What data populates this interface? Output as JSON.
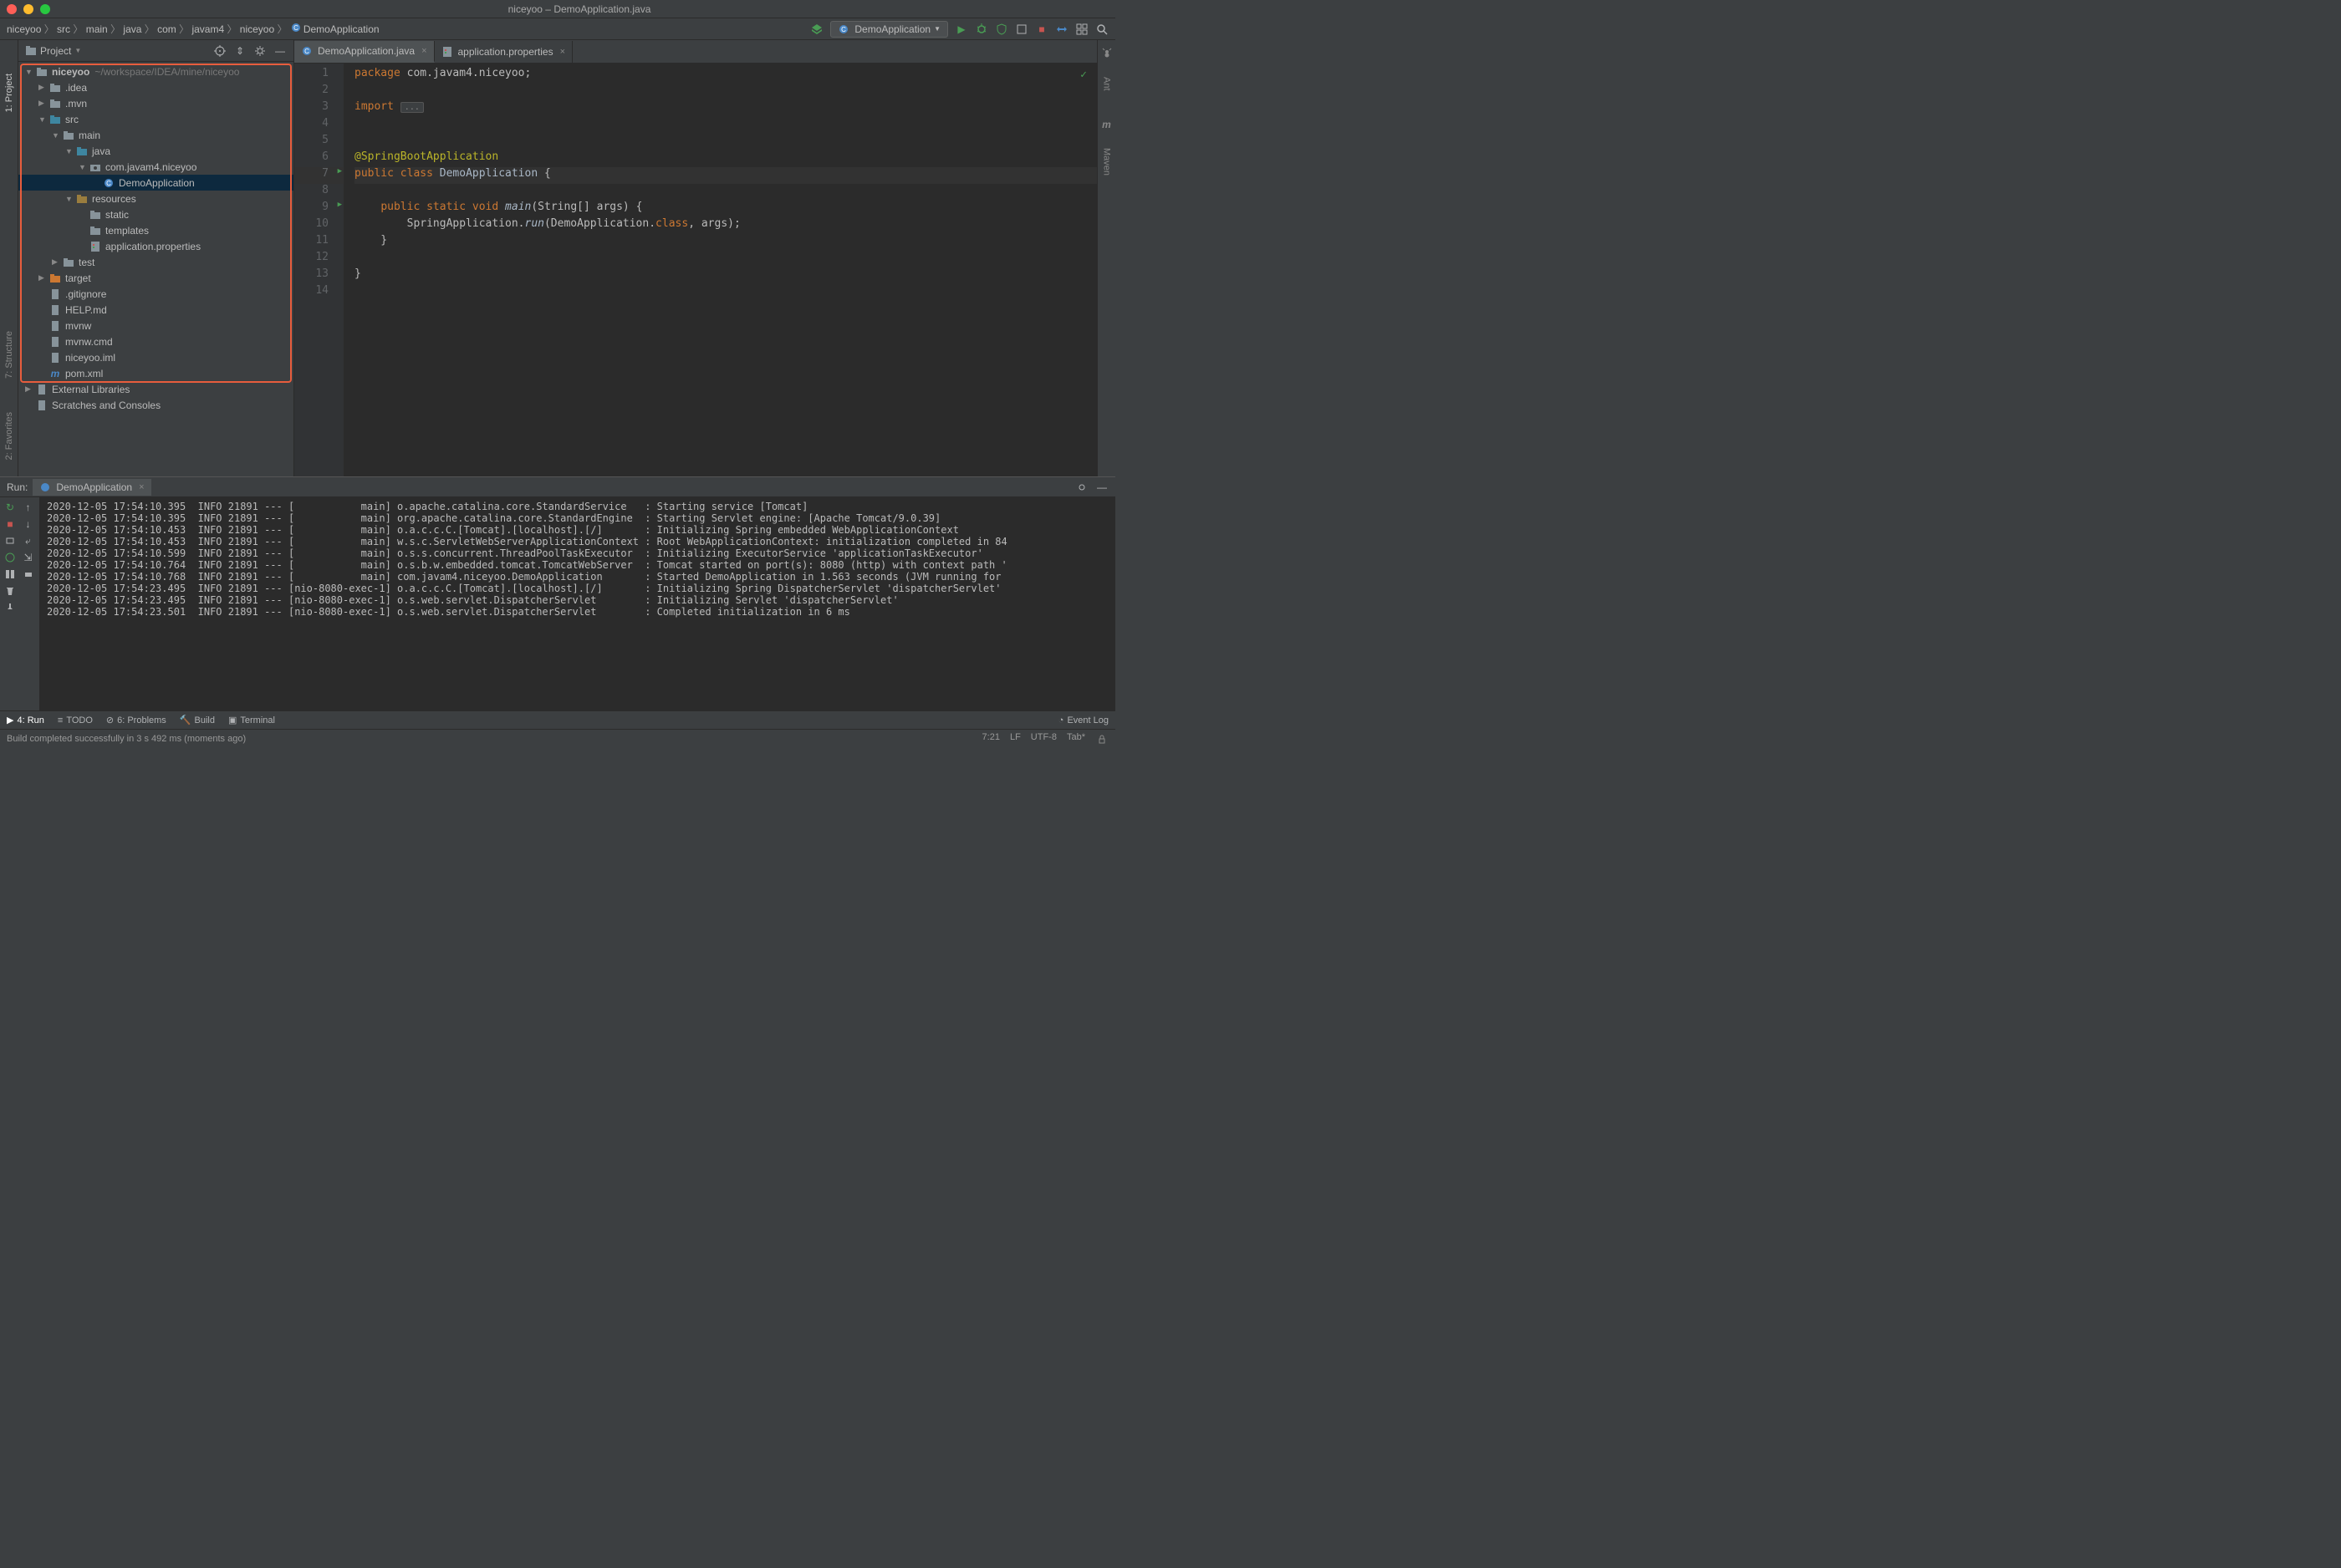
{
  "title": "niceyoo – DemoApplication.java",
  "breadcrumbs": [
    "niceyoo",
    "src",
    "main",
    "java",
    "com",
    "javam4",
    "niceyoo",
    "DemoApplication"
  ],
  "run_config": "DemoApplication",
  "left_tabs": {
    "project": "1: Project",
    "structure": "7: Structure",
    "favorites": "2: Favorites"
  },
  "right_tabs": {
    "ant": "Ant",
    "maven": "Maven"
  },
  "panel": {
    "title": "Project"
  },
  "tree": {
    "root": {
      "name": "niceyoo",
      "path": "~/workspace/IDEA/mine/niceyoo"
    },
    "children": [
      {
        "name": ".idea",
        "indent": 1,
        "arrow": ">",
        "icon": "folder"
      },
      {
        "name": ".mvn",
        "indent": 1,
        "arrow": ">",
        "icon": "folder"
      },
      {
        "name": "src",
        "indent": 1,
        "arrow": "v",
        "icon": "folder-src"
      },
      {
        "name": "main",
        "indent": 2,
        "arrow": "v",
        "icon": "folder"
      },
      {
        "name": "java",
        "indent": 3,
        "arrow": "v",
        "icon": "folder-src"
      },
      {
        "name": "com.javam4.niceyoo",
        "indent": 4,
        "arrow": "v",
        "icon": "package"
      },
      {
        "name": "DemoApplication",
        "indent": 5,
        "arrow": "",
        "icon": "class",
        "selected": true
      },
      {
        "name": "resources",
        "indent": 3,
        "arrow": "v",
        "icon": "folder-res"
      },
      {
        "name": "static",
        "indent": 4,
        "arrow": "",
        "icon": "folder"
      },
      {
        "name": "templates",
        "indent": 4,
        "arrow": "",
        "icon": "folder"
      },
      {
        "name": "application.properties",
        "indent": 4,
        "arrow": "",
        "icon": "props"
      },
      {
        "name": "test",
        "indent": 2,
        "arrow": ">",
        "icon": "folder"
      },
      {
        "name": "target",
        "indent": 1,
        "arrow": ">",
        "icon": "folder-target"
      },
      {
        "name": ".gitignore",
        "indent": 1,
        "arrow": "",
        "icon": "file"
      },
      {
        "name": "HELP.md",
        "indent": 1,
        "arrow": "",
        "icon": "file"
      },
      {
        "name": "mvnw",
        "indent": 1,
        "arrow": "",
        "icon": "file"
      },
      {
        "name": "mvnw.cmd",
        "indent": 1,
        "arrow": "",
        "icon": "file"
      },
      {
        "name": "niceyoo.iml",
        "indent": 1,
        "arrow": "",
        "icon": "file"
      },
      {
        "name": "pom.xml",
        "indent": 1,
        "arrow": "",
        "icon": "maven"
      }
    ],
    "external": "External Libraries",
    "scratches": "Scratches and Consoles"
  },
  "tabs": [
    {
      "name": "DemoApplication.java",
      "icon": "class",
      "active": true
    },
    {
      "name": "application.properties",
      "icon": "props",
      "active": false
    }
  ],
  "code_lines": [
    {
      "n": 1,
      "html": "<span class='kw'>package</span> com.javam4.niceyoo;"
    },
    {
      "n": 2,
      "html": ""
    },
    {
      "n": 3,
      "html": "<span class='kw'>import</span> <span class='fold'>...</span>"
    },
    {
      "n": 4,
      "html": ""
    },
    {
      "n": 5,
      "html": ""
    },
    {
      "n": 6,
      "html": "<span class='ann'>@SpringBootApplication</span>"
    },
    {
      "n": 7,
      "html": "<span class='kw'>public</span> <span class='kw'>class</span> <span class='cls'>DemoApplication</span> {",
      "active": true,
      "run": true
    },
    {
      "n": 8,
      "html": ""
    },
    {
      "n": 9,
      "html": "    <span class='kw'>public</span> <span class='kw'>static</span> <span class='kw'>void</span> <span class='fn'>main</span>(String[] args) {",
      "run": true
    },
    {
      "n": 10,
      "html": "        SpringApplication.<span class='fn'>run</span>(DemoApplication.<span class='kw'>class</span>, args);"
    },
    {
      "n": 11,
      "html": "    }"
    },
    {
      "n": 12,
      "html": ""
    },
    {
      "n": 13,
      "html": "}"
    },
    {
      "n": 14,
      "html": ""
    }
  ],
  "run": {
    "label": "Run:",
    "tab": "DemoApplication",
    "lines": [
      "2020-12-05 17:54:10.395  INFO 21891 --- [           main] o.apache.catalina.core.StandardService   : Starting service [Tomcat]",
      "2020-12-05 17:54:10.395  INFO 21891 --- [           main] org.apache.catalina.core.StandardEngine  : Starting Servlet engine: [Apache Tomcat/9.0.39]",
      "2020-12-05 17:54:10.453  INFO 21891 --- [           main] o.a.c.c.C.[Tomcat].[localhost].[/]       : Initializing Spring embedded WebApplicationContext",
      "2020-12-05 17:54:10.453  INFO 21891 --- [           main] w.s.c.ServletWebServerApplicationContext : Root WebApplicationContext: initialization completed in 84",
      "2020-12-05 17:54:10.599  INFO 21891 --- [           main] o.s.s.concurrent.ThreadPoolTaskExecutor  : Initializing ExecutorService 'applicationTaskExecutor'",
      "2020-12-05 17:54:10.764  INFO 21891 --- [           main] o.s.b.w.embedded.tomcat.TomcatWebServer  : Tomcat started on port(s): 8080 (http) with context path '",
      "2020-12-05 17:54:10.768  INFO 21891 --- [           main] com.javam4.niceyoo.DemoApplication       : Started DemoApplication in 1.563 seconds (JVM running for ",
      "2020-12-05 17:54:23.495  INFO 21891 --- [nio-8080-exec-1] o.a.c.c.C.[Tomcat].[localhost].[/]       : Initializing Spring DispatcherServlet 'dispatcherServlet'",
      "2020-12-05 17:54:23.495  INFO 21891 --- [nio-8080-exec-1] o.s.web.servlet.DispatcherServlet        : Initializing Servlet 'dispatcherServlet'",
      "2020-12-05 17:54:23.501  INFO 21891 --- [nio-8080-exec-1] o.s.web.servlet.DispatcherServlet        : Completed initialization in 6 ms"
    ]
  },
  "bottom": {
    "run": "4: Run",
    "todo": "TODO",
    "problems": "6: Problems",
    "build": "Build",
    "terminal": "Terminal",
    "event": "Event Log"
  },
  "status": {
    "msg": "Build completed successfully in 3 s 492 ms (moments ago)",
    "pos": "7:21",
    "lf": "LF",
    "enc": "UTF-8",
    "tab": "Tab*"
  }
}
